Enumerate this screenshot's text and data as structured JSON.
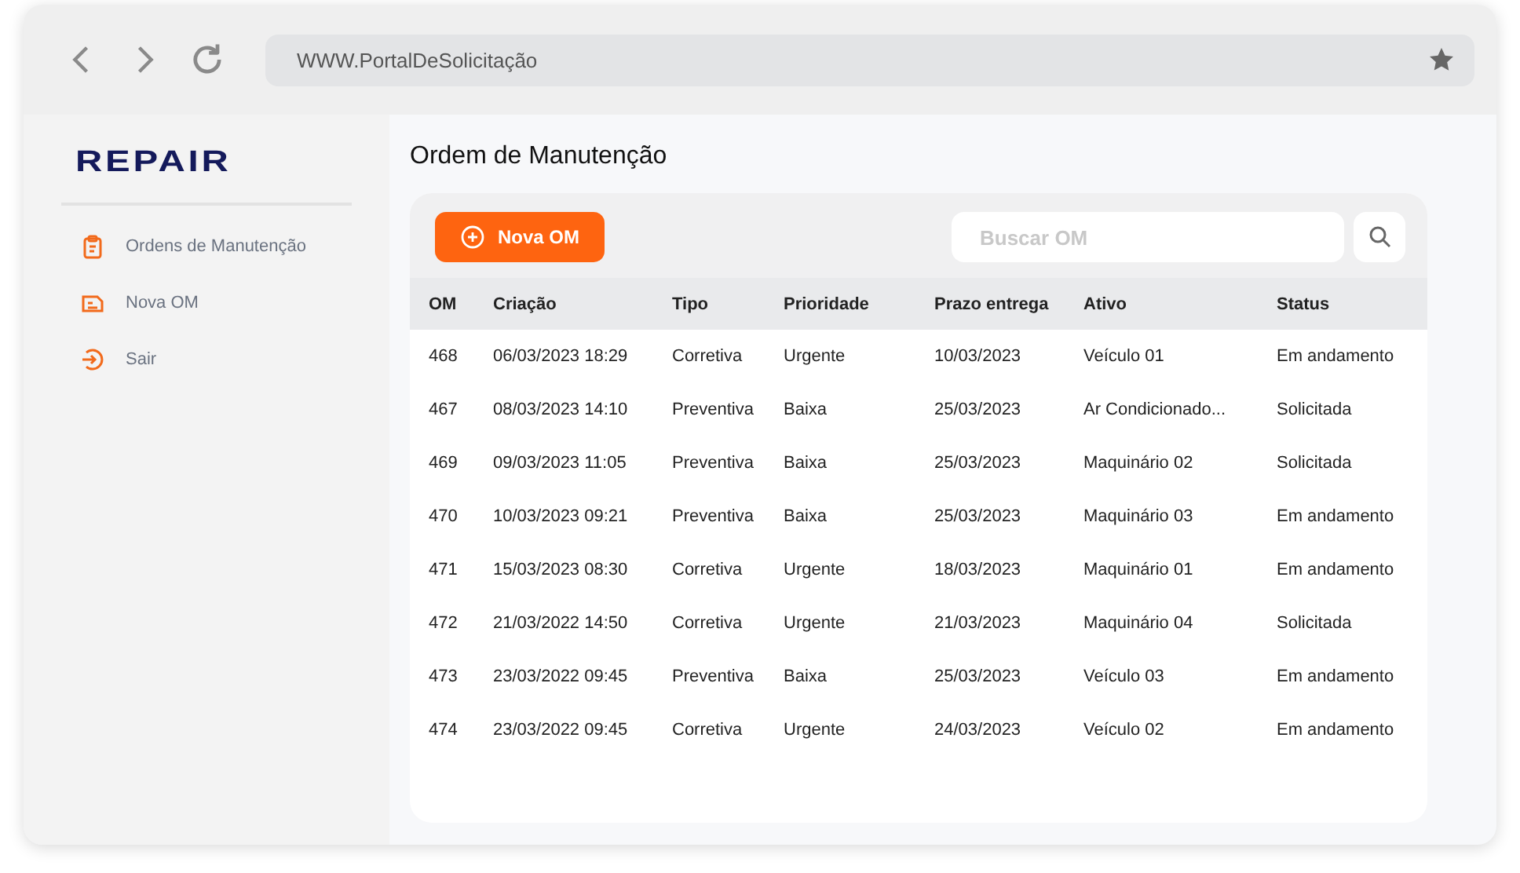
{
  "browser": {
    "url": "WWW.PortalDeSolicitação"
  },
  "sidebar": {
    "logo": "REPAIR",
    "items": [
      {
        "label": "Ordens de Manutenção",
        "kind": "clipboard"
      },
      {
        "label": "Nova OM",
        "kind": "document"
      },
      {
        "label": "Sair",
        "kind": "exit"
      }
    ]
  },
  "page_title": "Ordem de Manutenção",
  "toolbar": {
    "new_button": "Nova OM",
    "search": {
      "placeholder": "Buscar OM"
    }
  },
  "table": {
    "columns": [
      "OM",
      "Criação",
      "Tipo",
      "Prioridade",
      "Prazo entrega",
      "Ativo",
      "Status"
    ],
    "rows": [
      [
        "468",
        "06/03/2023 18:29",
        "Corretiva",
        "Urgente",
        "10/03/2023",
        "Veículo 01",
        "Em andamento"
      ],
      [
        "467",
        "08/03/2023 14:10",
        "Preventiva",
        "Baixa",
        "25/03/2023",
        "Ar Condicionado...",
        "Solicitada"
      ],
      [
        "469",
        "09/03/2023 11:05",
        "Preventiva",
        "Baixa",
        "25/03/2023",
        "Maquinário 02",
        "Solicitada"
      ],
      [
        "470",
        "10/03/2023 09:21",
        "Preventiva",
        "Baixa",
        "25/03/2023",
        "Maquinário 03",
        "Em andamento"
      ],
      [
        "471",
        "15/03/2023 08:30",
        "Corretiva",
        "Urgente",
        "18/03/2023",
        "Maquinário 01",
        "Em andamento"
      ],
      [
        "472",
        "21/03/2022 14:50",
        "Corretiva",
        "Urgente",
        "21/03/2023",
        "Maquinário 04",
        "Solicitada"
      ],
      [
        "473",
        "23/03/2022 09:45",
        "Preventiva",
        "Baixa",
        "25/03/2023",
        "Veículo 03",
        "Em andamento"
      ],
      [
        "474",
        "23/03/2022 09:45",
        "Corretiva",
        "Urgente",
        "24/03/2023",
        "Veículo 02",
        "Em andamento"
      ]
    ]
  }
}
